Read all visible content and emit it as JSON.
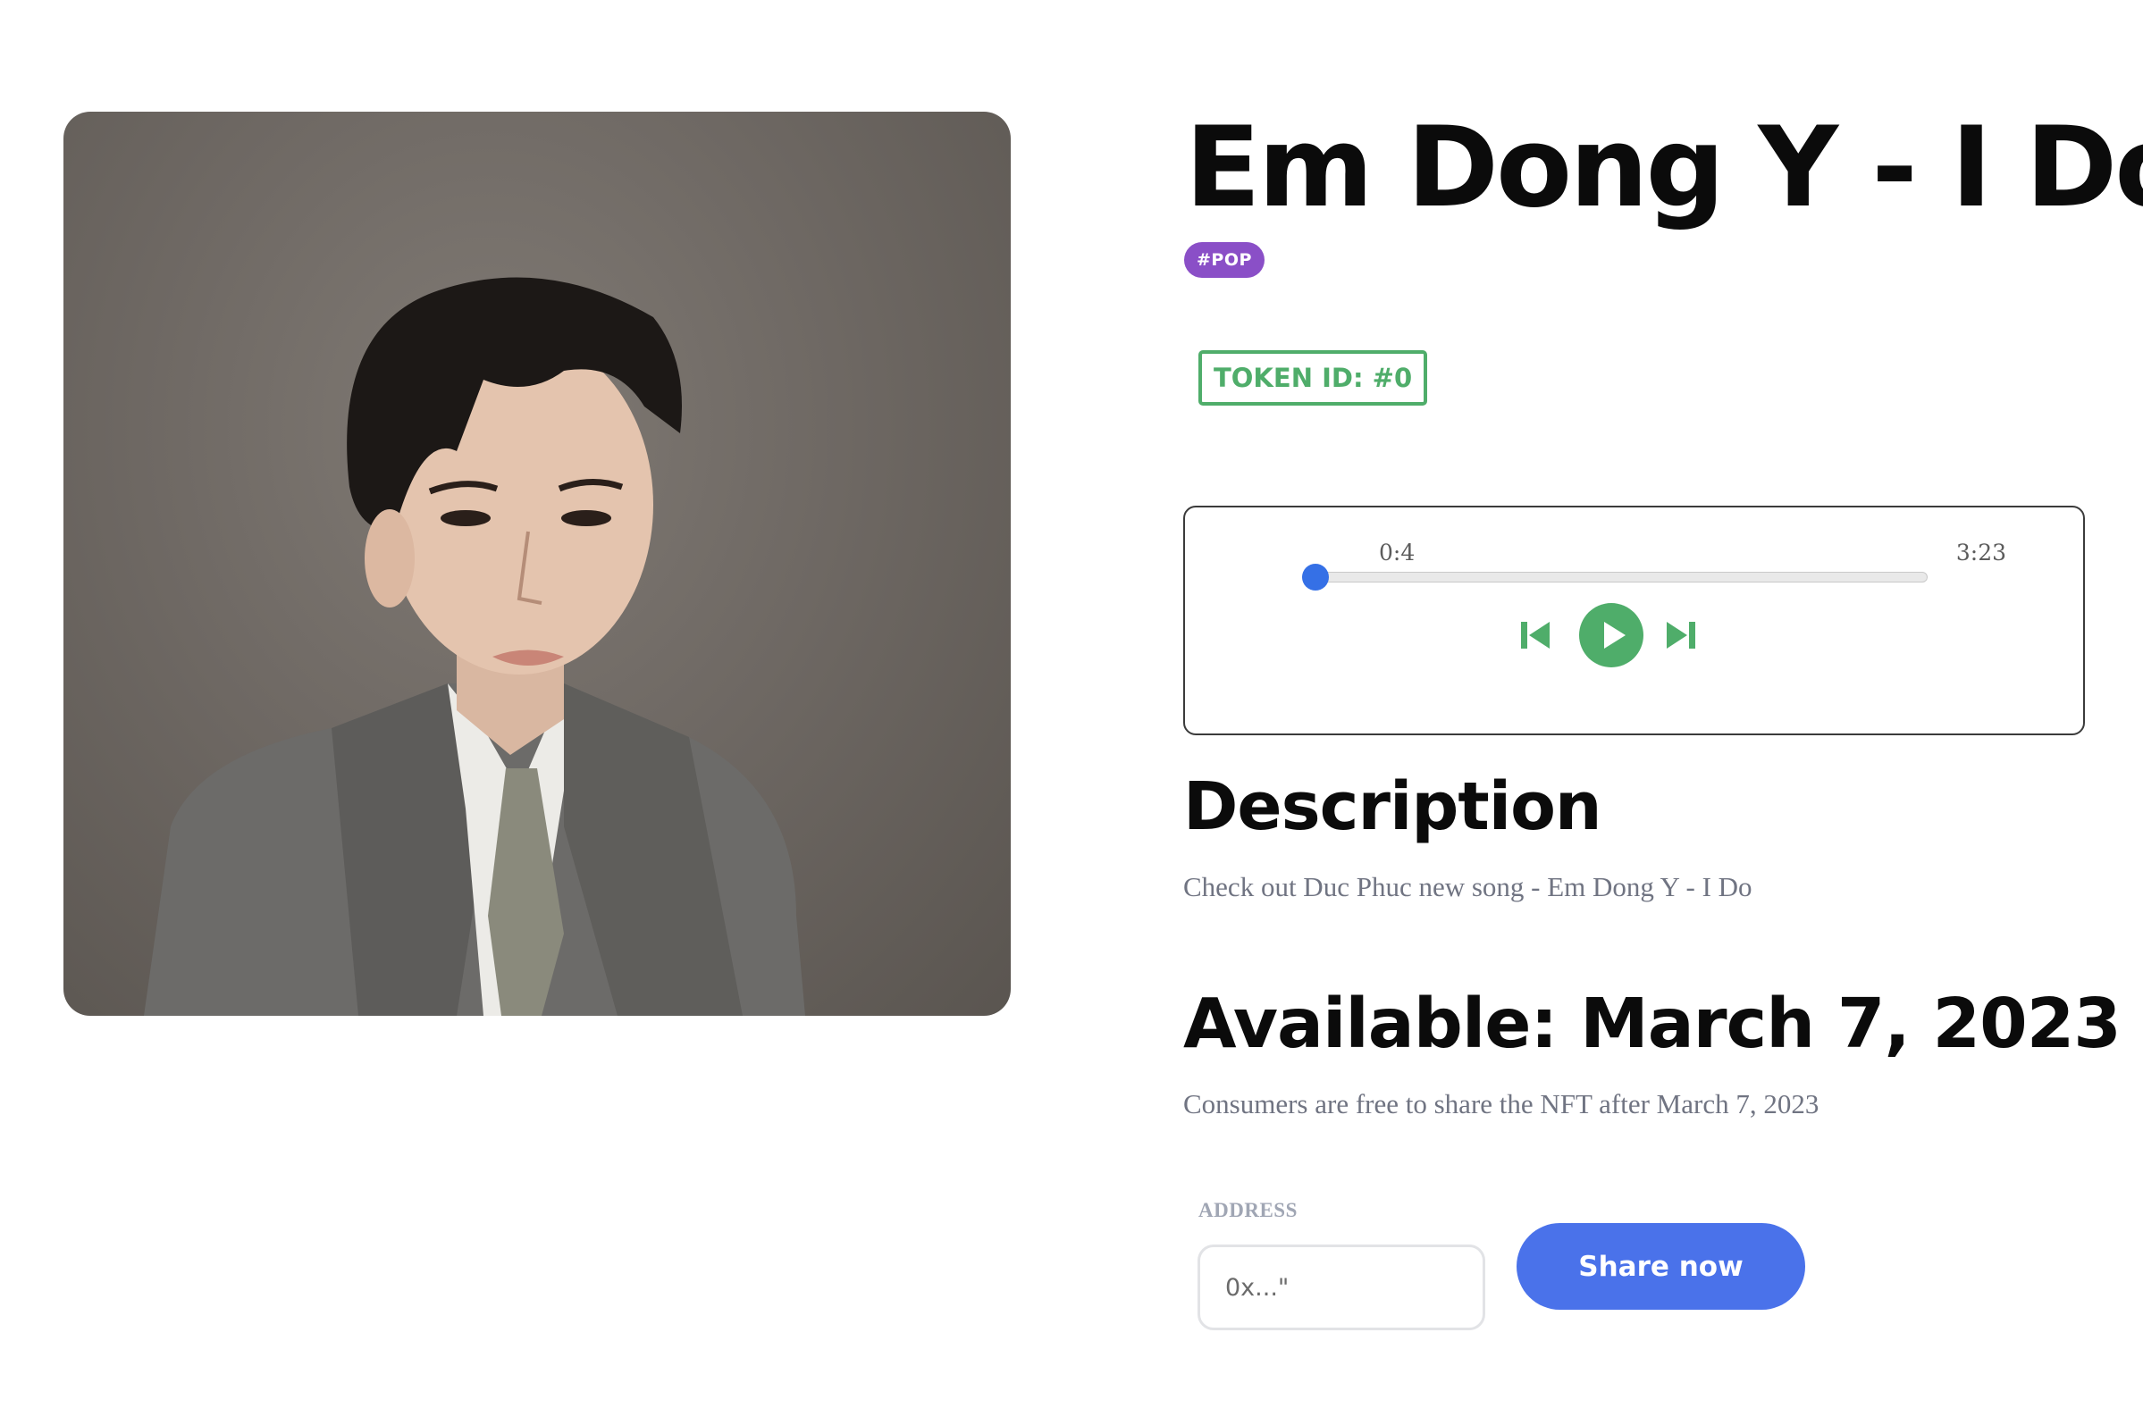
{
  "song": {
    "title": "Em Dong Y - I Do",
    "genre_tag": "#POP",
    "token_badge": "TOKEN ID: #0"
  },
  "artwork": {
    "icon": "artist-portrait-image"
  },
  "player": {
    "current_time": "0:4",
    "total_time": "3:23",
    "progress_fraction": 0.02,
    "icons": {
      "previous": "skip-previous-icon",
      "play": "play-icon",
      "next": "skip-next-icon"
    }
  },
  "description": {
    "heading": "Description",
    "text": "Check out Duc Phuc new song - Em Dong Y - I Do"
  },
  "availability": {
    "heading": "Available: March 7, 2023",
    "text": "Consumers are free to share the NFT after March 7, 2023"
  },
  "share_form": {
    "address_label": "ADDRESS",
    "address_placeholder": "0x...\"",
    "address_value": "",
    "button_label": "Share now"
  },
  "colors": {
    "genre_tag": "#8a4fc7",
    "token_badge": "#4fad6a",
    "player_controls": "#4fad6a",
    "progress": "#3570e6",
    "share_button": "#4a72ea",
    "muted_text": "#707482"
  }
}
